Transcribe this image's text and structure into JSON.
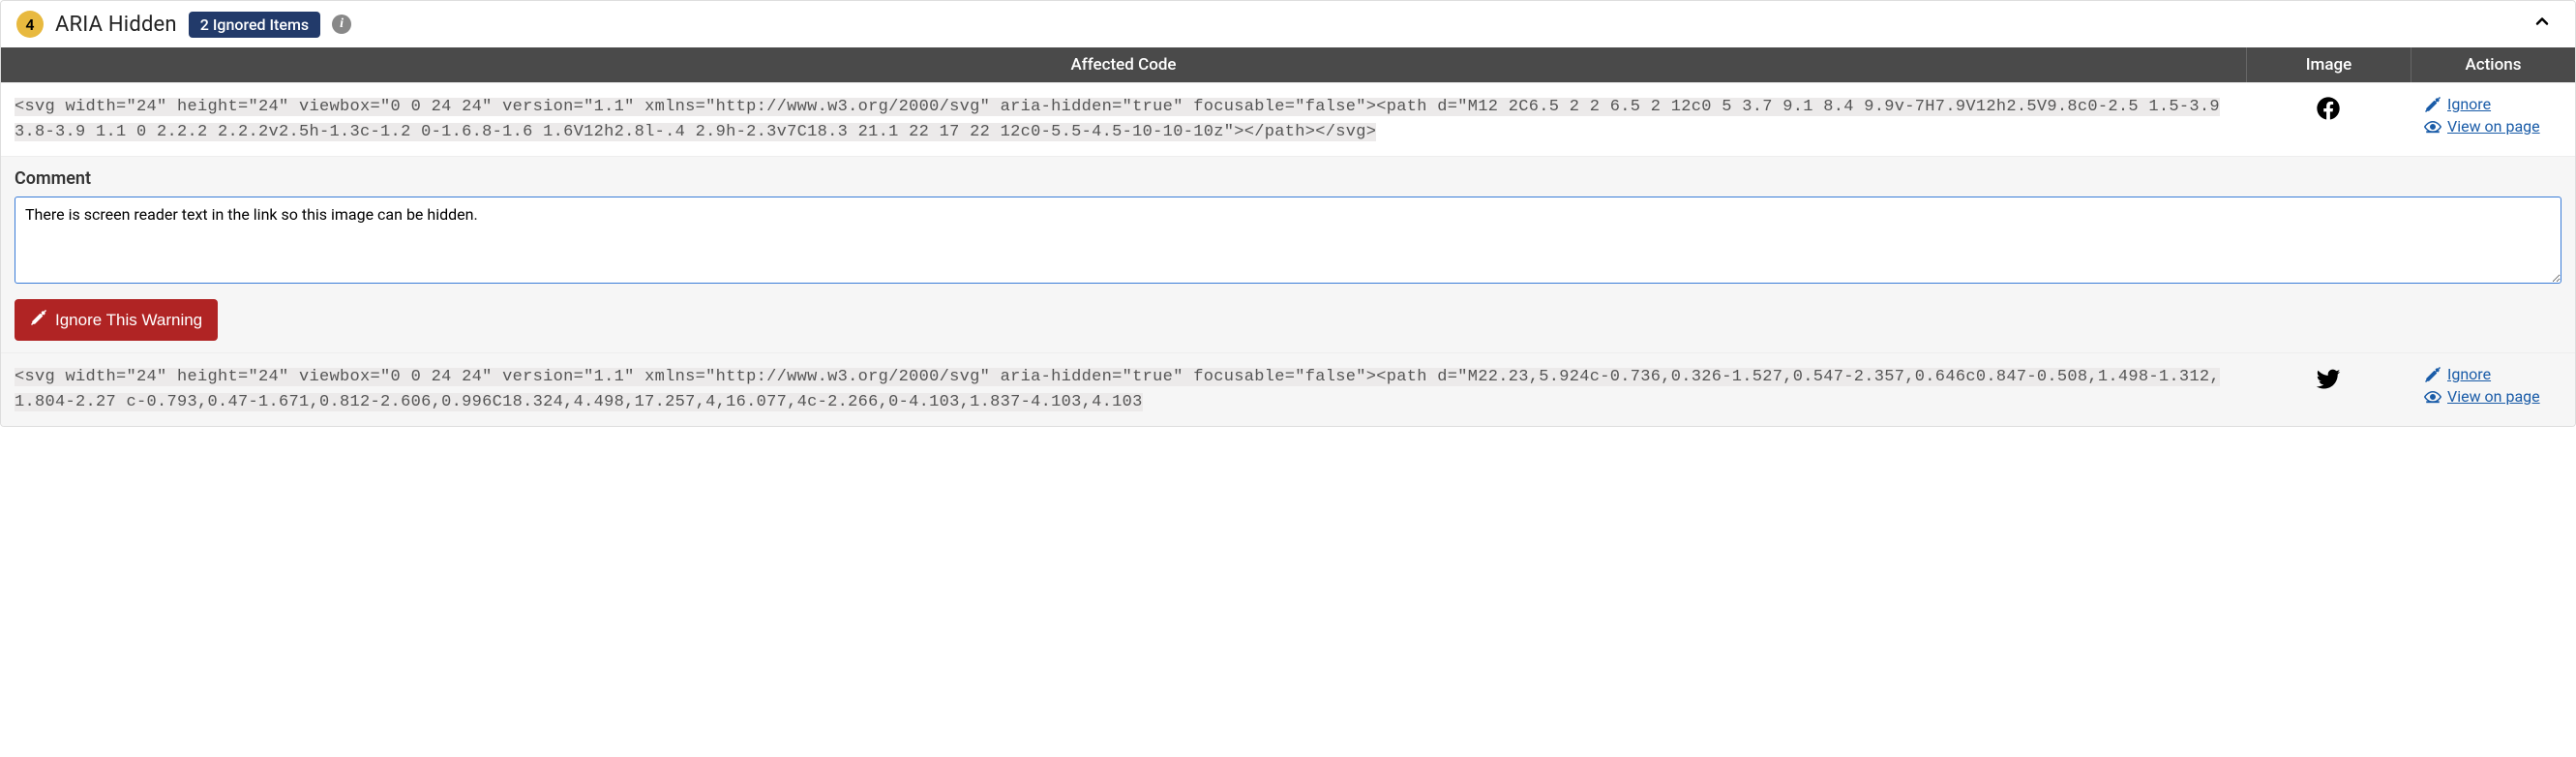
{
  "header": {
    "count": "4",
    "title": "ARIA Hidden",
    "pill": "2 Ignored Items"
  },
  "columns": {
    "code": "Affected Code",
    "image": "Image",
    "actions": "Actions"
  },
  "rows": [
    {
      "code": "<svg width=\"24\" height=\"24\" viewbox=\"0 0 24 24\" version=\"1.1\" xmlns=\"http://www.w3.org/2000/svg\" aria-hidden=\"true\" focusable=\"false\"><path d=\"M12 2C6.5 2 2 6.5 2 12c0 5 3.7 9.1 8.4 9.9v-7H7.9V12h2.5V9.8c0-2.5 1.5-3.9 3.8-3.9 1.1 0 2.2.2 2.2.2v2.5h-1.3c-1.2 0-1.6.8-1.6 1.6V12h2.8l-.4 2.9h-2.3v7C18.3 21.1 22 17 22 12c0-5.5-4.5-10-10-10z\"></path></svg>",
      "icon": "facebook",
      "ignore_label": "Ignore",
      "view_label": "View on page"
    },
    {
      "code": "<svg width=\"24\" height=\"24\" viewbox=\"0 0 24 24\" version=\"1.1\" xmlns=\"http://www.w3.org/2000/svg\" aria-hidden=\"true\" focusable=\"false\"><path d=\"M22.23,5.924c-0.736,0.326-1.527,0.547-2.357,0.646c0.847-0.508,1.498-1.312,1.804-2.27 c-0.793,0.47-1.671,0.812-2.606,0.996C18.324,4.498,17.257,4,16.077,4c-2.266,0-4.103,1.837-4.103,4.103",
      "icon": "twitter",
      "ignore_label": "Ignore",
      "view_label": "View on page"
    }
  ],
  "comment": {
    "label": "Comment",
    "value": "There is screen reader text in the link so this image can be hidden."
  },
  "ignore_button": "Ignore This Warning"
}
